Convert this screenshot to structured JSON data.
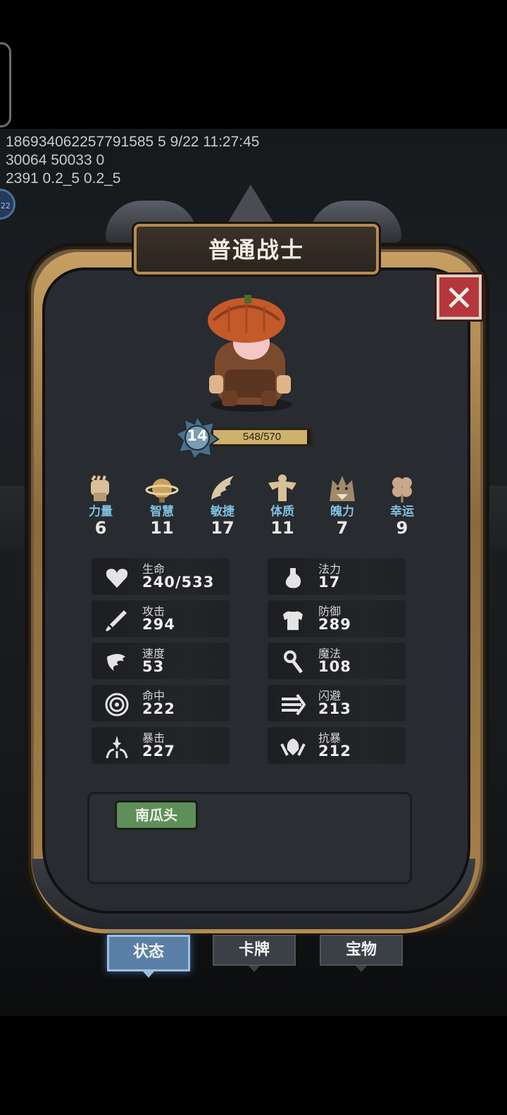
{
  "debug": {
    "line1": "186934062257791585 5 9/22 11:27:45",
    "line2": "30064 50033 0",
    "line3": "2391 0.2_5 0.2_5",
    "badge": "22"
  },
  "dialog": {
    "title": "普通战士",
    "close_icon": "close-x-icon"
  },
  "character": {
    "level": "14",
    "xp_text": "548/570",
    "xp_fraction": 0.961
  },
  "attributes": [
    {
      "label": "力量",
      "value": "6",
      "icon": "fist-icon"
    },
    {
      "label": "智慧",
      "value": "11",
      "icon": "globe-icon"
    },
    {
      "label": "敏捷",
      "value": "17",
      "icon": "wing-icon"
    },
    {
      "label": "体质",
      "value": "11",
      "icon": "muscle-icon"
    },
    {
      "label": "魄力",
      "value": "7",
      "icon": "wolf-icon"
    },
    {
      "label": "幸运",
      "value": "9",
      "icon": "clover-icon"
    }
  ],
  "stats_left": [
    {
      "name": "生命",
      "value": "240/533",
      "icon": "heart-icon"
    },
    {
      "name": "攻击",
      "value": "294",
      "icon": "sword-icon"
    },
    {
      "name": "速度",
      "value": "53",
      "icon": "wind-icon"
    },
    {
      "name": "命中",
      "value": "222",
      "icon": "target-icon"
    },
    {
      "name": "暴击",
      "value": "227",
      "icon": "crit-icon"
    }
  ],
  "stats_right": [
    {
      "name": "法力",
      "value": "17",
      "icon": "potion-icon"
    },
    {
      "name": "防御",
      "value": "289",
      "icon": "armor-icon"
    },
    {
      "name": "魔法",
      "value": "108",
      "icon": "staff-icon"
    },
    {
      "name": "闪避",
      "value": "213",
      "icon": "dodge-icon"
    },
    {
      "name": "抗暴",
      "value": "212",
      "icon": "shield-icon"
    }
  ],
  "traits": [
    "南瓜头"
  ],
  "tabs": [
    {
      "label": "状态",
      "active": true
    },
    {
      "label": "卡牌",
      "active": false
    },
    {
      "label": "宝物",
      "active": false
    }
  ]
}
